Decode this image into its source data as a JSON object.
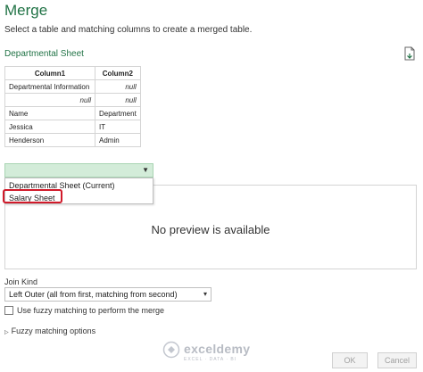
{
  "dialog": {
    "title": "Merge",
    "subtitle": "Select a table and matching columns to create a merged table."
  },
  "first_table": {
    "label": "Departmental Sheet",
    "columns": [
      "Column1",
      "Column2"
    ],
    "rows": [
      [
        "Departmental Information",
        "null"
      ],
      [
        "null",
        "null"
      ],
      [
        "Name",
        "Department"
      ],
      [
        "Jessica",
        "IT"
      ],
      [
        "Henderson",
        "Admin"
      ]
    ]
  },
  "second_table": {
    "selected_value": "",
    "options": [
      "Departmental Sheet (Current)",
      "Salary Sheet"
    ],
    "highlighted_option": "Salary Sheet",
    "preview_message": "No preview is available"
  },
  "join": {
    "label": "Join Kind",
    "selected": "Left Outer (all from first, matching from second)",
    "fuzzy_checkbox_label": "Use fuzzy matching to perform the merge",
    "fuzzy_checked": false,
    "fuzzy_options_label": "Fuzzy matching options"
  },
  "watermark": {
    "name": "exceldemy",
    "tagline": "EXCEL · DATA · BI"
  },
  "buttons": {
    "ok": "OK",
    "cancel": "Cancel"
  },
  "colors": {
    "accent_green": "#217346",
    "dropdown_fill": "#d3ecd9",
    "highlight_red": "#d11a2a"
  }
}
